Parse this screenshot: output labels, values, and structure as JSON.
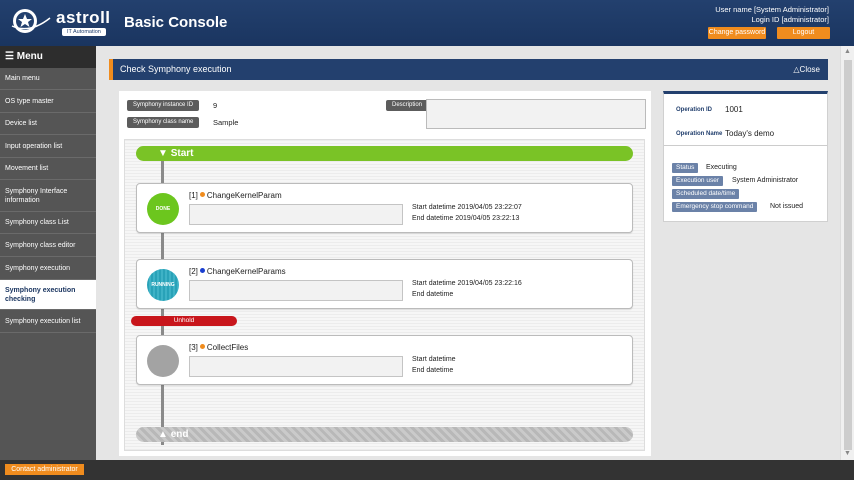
{
  "header": {
    "logo_text": "astroll",
    "logo_sub": "IT Automation",
    "app_title": "Basic Console",
    "user_name": "User name [System Administrator]",
    "login_id": "Login ID [administrator]",
    "change_password_label": "Change password",
    "logout_label": "Logout"
  },
  "sidebar": {
    "menu_title": "Menu",
    "items": [
      {
        "label": "Main menu"
      },
      {
        "label": "OS type master"
      },
      {
        "label": "Device list"
      },
      {
        "label": "Input operation list"
      },
      {
        "label": "Movement list"
      },
      {
        "label": "Symphony Interface information"
      },
      {
        "label": "Symphony class List"
      },
      {
        "label": "Symphony class editor"
      },
      {
        "label": "Symphony execution"
      },
      {
        "label": "Symphony execution checking"
      },
      {
        "label": "Symphony execution list"
      }
    ]
  },
  "main": {
    "title": "Check Symphony execution",
    "close_label": "Close",
    "instance_id_label": "Symphony instance ID",
    "instance_id": "9",
    "class_name_label": "Symphony class name",
    "class_name": "Sample",
    "description_label": "Description",
    "start_label": "Start",
    "end_label": "end",
    "unhold_label": "Unhold",
    "nodes": [
      {
        "index": "[1]",
        "name": "ChangeKernelParam",
        "status_text": "DONE",
        "dot_color": "#f08c1e",
        "start": "Start datetime 2019/04/05 23:22:07",
        "end": "End datetime 2019/04/05 23:22:13"
      },
      {
        "index": "[2]",
        "name": "ChangeKernelParams",
        "status_text": "RUNNING",
        "dot_color": "#1a3fd0",
        "start": "Start datetime 2019/04/05 23:22:16",
        "end": "End datetime"
      },
      {
        "index": "[3]",
        "name": "CollectFiles",
        "status_text": "",
        "dot_color": "#f08c1e",
        "start": "Start datetime",
        "end": "End datetime"
      }
    ]
  },
  "operation": {
    "id_label": "Operation ID",
    "id": "1001",
    "name_label": "Operation Name",
    "name": "Today's demo",
    "status_label": "Status",
    "status": "Executing",
    "exec_user_label": "Execution user",
    "exec_user": "System Administrator",
    "scheduled_label": "Scheduled date/time",
    "scheduled": "",
    "emergency_label": "Emergency stop command",
    "emergency": "Not issued"
  },
  "footer": {
    "contact_label": "Contact administrator"
  },
  "colors": {
    "header": "#23406e",
    "accent": "#f08c1e",
    "done": "#6cc61e",
    "running": "#29a2b8",
    "unhold": "#c8151b",
    "start_bar": "#7ac326"
  }
}
